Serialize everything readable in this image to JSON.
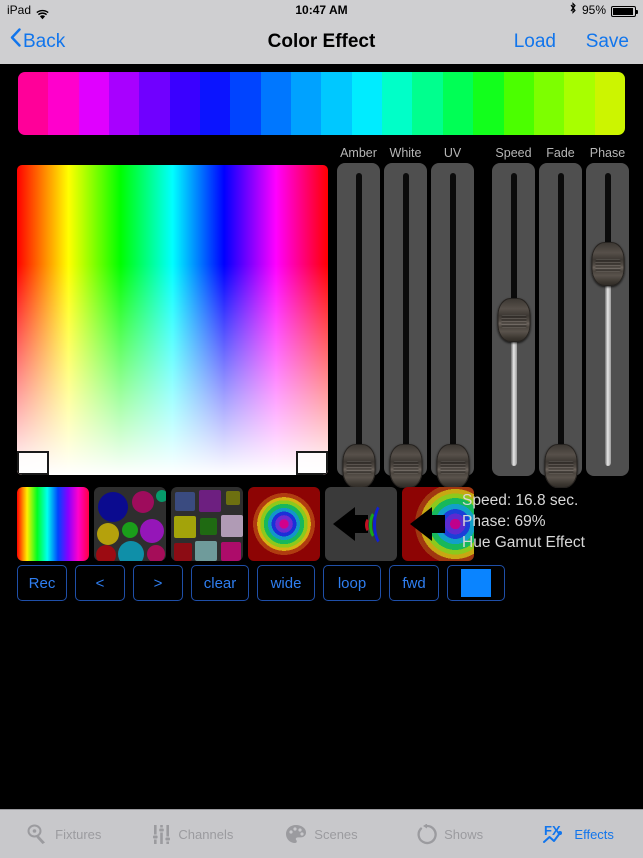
{
  "status_bar": {
    "device": "iPad",
    "wifi_icon": "wifi-icon",
    "time": "10:47 AM",
    "bluetooth_icon": "bluetooth-icon",
    "battery_percent": "95%",
    "battery_icon": "battery-icon"
  },
  "nav_bar": {
    "back_label": "Back",
    "back_icon": "chevron-left-icon",
    "title": "Color Effect",
    "load_label": "Load",
    "save_label": "Save"
  },
  "hue_strip": {
    "name": "hue-gamut-strip",
    "swatches": [
      "#ff0099",
      "#ff00cc",
      "#e000ff",
      "#a800ff",
      "#7000ff",
      "#3a00ff",
      "#0b14ff",
      "#0044ff",
      "#0077ff",
      "#00a2ff",
      "#00c8ff",
      "#00ecff",
      "#00ffc8",
      "#00ff8e",
      "#00ff55",
      "#12ff1c",
      "#4bff00",
      "#7dff00",
      "#a8ff00",
      "#ccf500"
    ]
  },
  "color_picker": {
    "name": "hue-saturation-picker",
    "markers": [
      "left-marker",
      "right-marker"
    ]
  },
  "faders": [
    {
      "label": "Amber",
      "value": 0,
      "filled": false
    },
    {
      "label": "White",
      "value": 0,
      "filled": false
    },
    {
      "label": "UV",
      "value": 0,
      "filled": false
    },
    {
      "label": "Speed",
      "value": 50,
      "filled": true
    },
    {
      "label": "Fade",
      "value": 0,
      "filled": false
    },
    {
      "label": "Phase",
      "value": 69,
      "filled": true
    }
  ],
  "presets": [
    {
      "name": "preset-rainbow-gradient"
    },
    {
      "name": "preset-color-dots"
    },
    {
      "name": "preset-color-squares"
    },
    {
      "name": "preset-radial-rings"
    },
    {
      "name": "preset-sound-waves"
    },
    {
      "name": "preset-sound-radial"
    }
  ],
  "info": {
    "speed": "Speed: 16.8 sec.",
    "phase": "Phase: 69%",
    "effect": "Hue Gamut Effect"
  },
  "buttons": [
    {
      "label": "Rec",
      "name": "rec-button"
    },
    {
      "label": "<",
      "name": "prev-button"
    },
    {
      "label": ">",
      "name": "next-button"
    },
    {
      "label": "clear",
      "name": "clear-button"
    },
    {
      "label": "wide",
      "name": "wide-button"
    },
    {
      "label": "loop",
      "name": "loop-button"
    },
    {
      "label": "fwd",
      "name": "fwd-button"
    }
  ],
  "color_swatch_button": {
    "name": "color-swatch-button",
    "color": "#0a84ff"
  },
  "tab_bar": [
    {
      "label": "Fixtures",
      "icon": "spotlight-icon",
      "active": false
    },
    {
      "label": "Channels",
      "icon": "faders-icon",
      "active": false
    },
    {
      "label": "Scenes",
      "icon": "palette-icon",
      "active": false
    },
    {
      "label": "Shows",
      "icon": "loop-arrow-icon",
      "active": false
    },
    {
      "label": "Effects",
      "icon": "fx-icon",
      "active": true
    }
  ],
  "colors": {
    "accent": "#1175ec",
    "chrome": "#cfcfd1",
    "background": "#000000",
    "fader_body": "#4f4f4f"
  }
}
